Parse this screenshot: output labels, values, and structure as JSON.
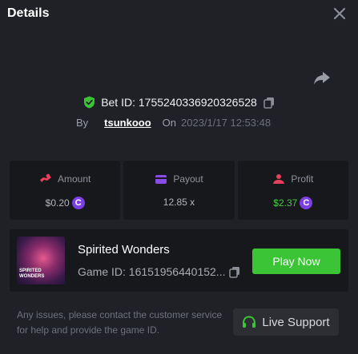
{
  "header": {
    "title": "Details",
    "close_icon": "close-icon"
  },
  "bet": {
    "share_icon": "share-icon",
    "verified_icon": "shield-check-icon",
    "bet_id_text": "Bet ID: 1755240336920326528",
    "copy_icon": "copy-icon",
    "by_label": "By",
    "username": "tsunkooo",
    "on_label": "On",
    "date": "2023/1/17 12:53:48"
  },
  "stats": [
    {
      "label": "Amount",
      "value": "$0.20",
      "icon": "amount-icon",
      "coin": true
    },
    {
      "label": "Payout",
      "value": "12.85 x",
      "icon": "wallet-icon",
      "coin": false
    },
    {
      "label": "Profit",
      "value": "$2.37",
      "icon": "profit-icon",
      "coin": true
    }
  ],
  "currency_symbol": "C",
  "game": {
    "name": "Spirited Wonders",
    "game_id": "Game ID: 16151956440152...",
    "thumb_text_1": "SPIRITED",
    "thumb_text_2": "WONDERS",
    "play_label": "Play Now"
  },
  "support": {
    "note": "Any issues, please contact the customer service for help and provide the game ID.",
    "button_label": "Live Support",
    "icon": "headset-icon"
  },
  "colors": {
    "background": "#1f2126",
    "card": "#17181c",
    "accent_green": "#3bc435",
    "coin_purple": "#7b3fe4",
    "profit_green": "#3fcc3f"
  }
}
